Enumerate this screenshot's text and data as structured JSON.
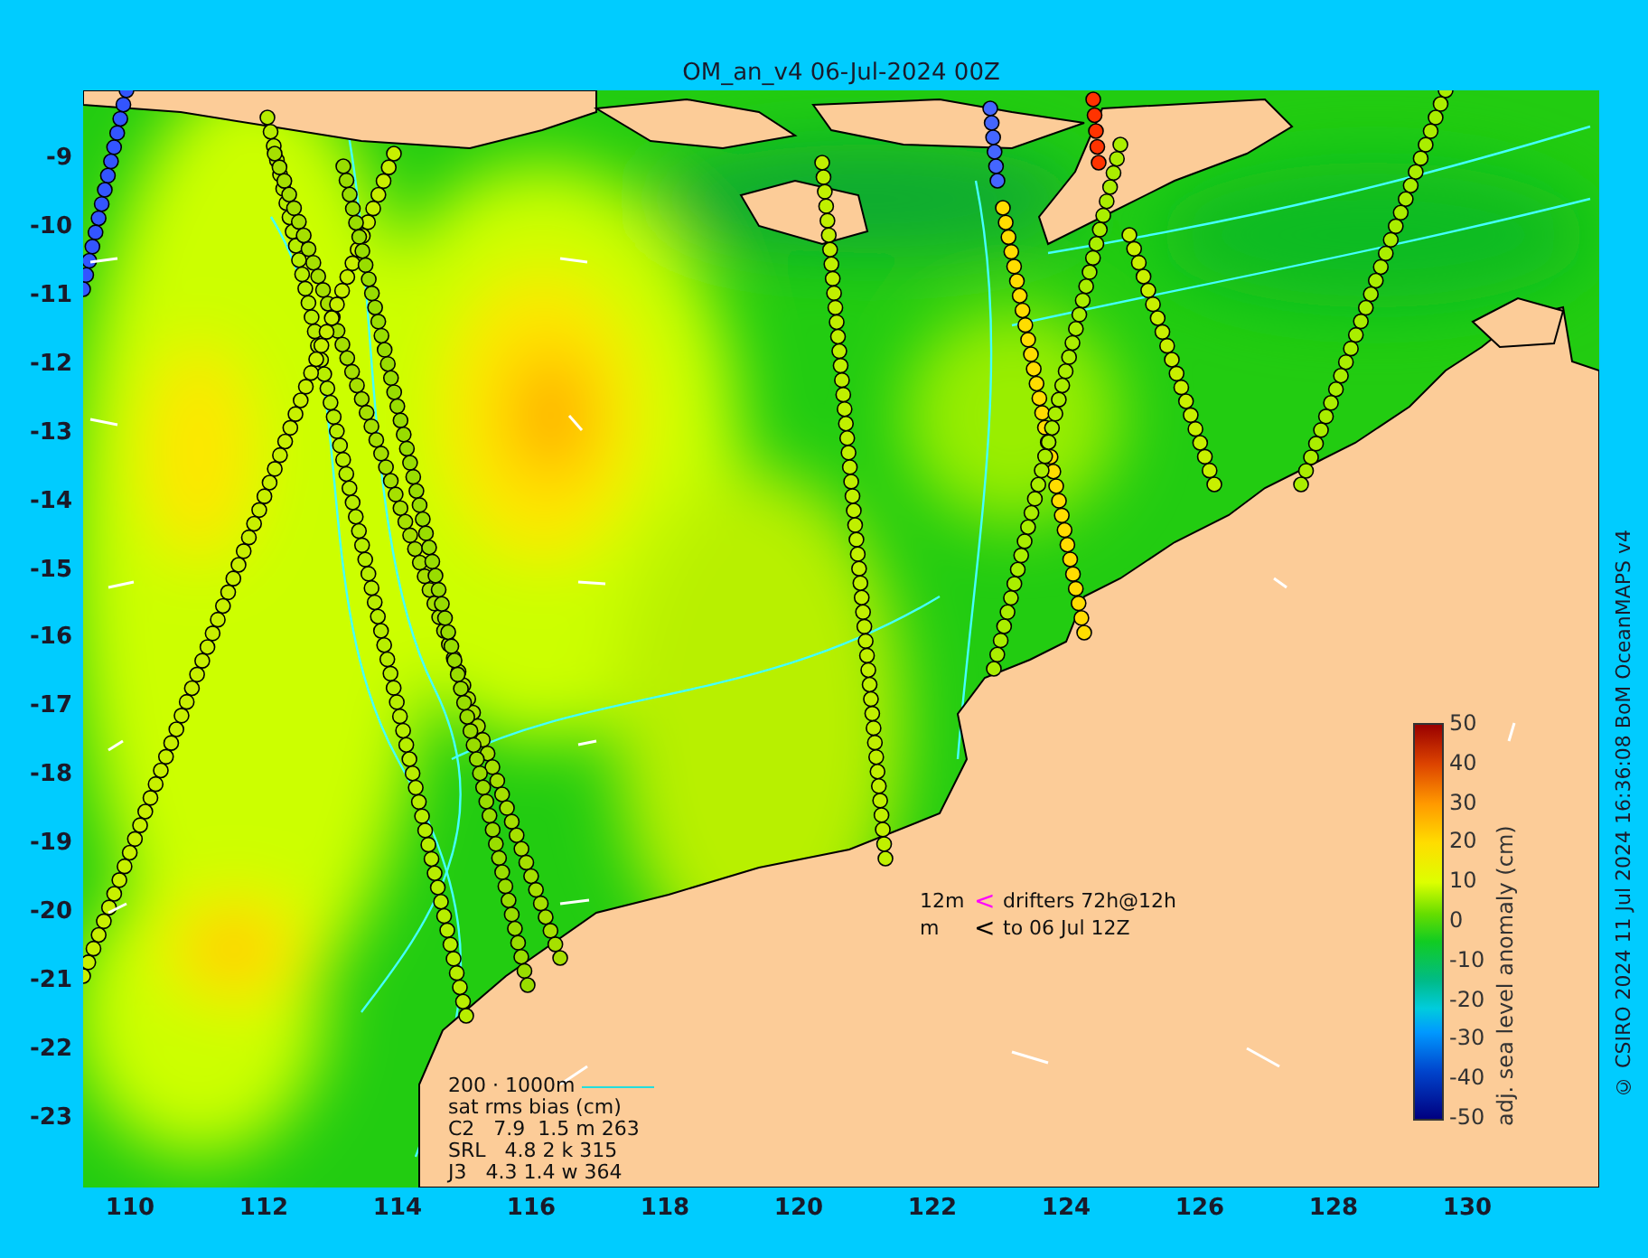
{
  "title": "OM_an_v4  06-Jul-2024 00Z",
  "credit": "© CSIRO 2024   11 Jul 2024 16:36:08 BoM OceanMAPS v4",
  "y_axis": {
    "ticks": [
      "-9",
      "-10",
      "-11",
      "-12",
      "-13",
      "-14",
      "-15",
      "-16",
      "-17",
      "-18",
      "-19",
      "-20",
      "-21",
      "-22",
      "-23"
    ]
  },
  "x_axis": {
    "ticks": [
      "110",
      "112",
      "114",
      "116",
      "118",
      "120",
      "122",
      "124",
      "126",
      "128",
      "130"
    ]
  },
  "colorbar": {
    "label": "adj. sea level anomaly (cm)",
    "ticks": [
      "50",
      "40",
      "30",
      "20",
      "10",
      "0",
      "-10",
      "-20",
      "-30",
      "-40",
      "-50"
    ]
  },
  "drifter_legend": [
    {
      "depth": "12m",
      "symbol": "<",
      "color": "#ff00ff",
      "text": "drifters 72h@12h"
    },
    {
      "depth": "m",
      "symbol": "<",
      "color": "#000000",
      "text": "to 06 Jul 12Z"
    }
  ],
  "stats": {
    "isobaths": "200 · 1000m",
    "heading": "sat rms bias (cm)",
    "rows": [
      "C2   7.9  1.5 m 263",
      "SRL   4.8 2 k 315",
      "J3   4.3 1.4 w 364"
    ]
  }
}
